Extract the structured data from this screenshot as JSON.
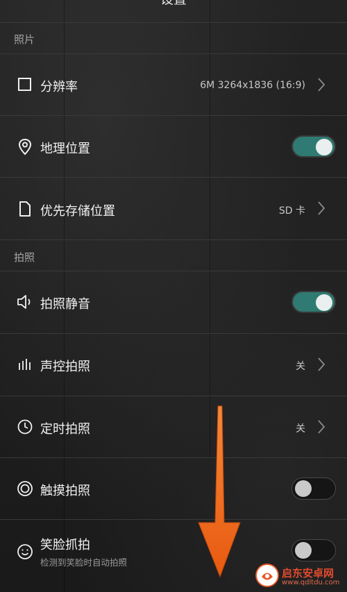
{
  "header": {
    "title": "设置"
  },
  "sections": {
    "photo": "照片",
    "shoot": "拍照"
  },
  "rows": {
    "resolution": {
      "label": "分辨率",
      "value": "6M 3264x1836 (16:9)",
      "icon": "square-icon"
    },
    "location": {
      "label": "地理位置",
      "toggle": true,
      "icon": "location-pin-icon"
    },
    "storage": {
      "label": "优先存储位置",
      "value": "SD 卡",
      "icon": "file-icon"
    },
    "mute": {
      "label": "拍照静音",
      "toggle": true,
      "icon": "speaker-icon"
    },
    "voice": {
      "label": "声控拍照",
      "value": "关",
      "icon": "voice-bars-icon"
    },
    "timer": {
      "label": "定时拍照",
      "value": "关",
      "icon": "clock-icon"
    },
    "touch": {
      "label": "触摸拍照",
      "toggle": false,
      "icon": "touch-circle-icon"
    },
    "smile": {
      "label": "笑脸抓拍",
      "sub": "检测到笑脸时自动拍照",
      "toggle": false,
      "icon": "smile-icon"
    }
  },
  "watermark": {
    "line1": "启东安卓网",
    "line2": "www.qdltdu.com"
  },
  "colors": {
    "toggle_on": "#2f7a72",
    "arrow": "#f06a1a",
    "background": "#1e1e1e"
  }
}
